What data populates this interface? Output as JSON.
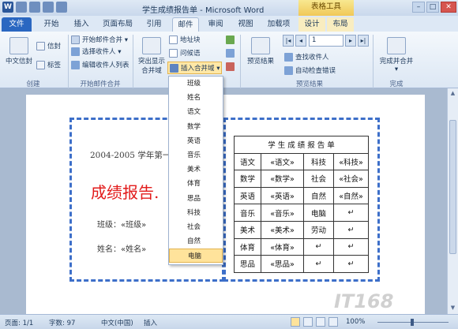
{
  "window": {
    "title": "学生成绩报告单 - Microsoft Word",
    "context_tab_group": "表格工具",
    "minimize": "–",
    "maximize": "□",
    "close": "✕"
  },
  "tabs": [
    "文件",
    "开始",
    "插入",
    "页面布局",
    "引用",
    "邮件",
    "审阅",
    "视图",
    "加载项",
    "设计",
    "布局"
  ],
  "ribbon": {
    "create_group": {
      "label": "创建",
      "envelope": "中文信封",
      "envelopes": "信封",
      "labels": "标签"
    },
    "start_group": {
      "label": "开始邮件合并",
      "start": "开始邮件合并 ▾",
      "select": "选择收件人 ▾",
      "edit": "编辑收件人列表"
    },
    "write_group": {
      "highlight": "突出显示",
      "highlight2": "合并域",
      "address": "地址块",
      "greeting": "问候语",
      "insert_field": "插入合并域 ▾"
    },
    "preview_group": {
      "label": "预览结果",
      "preview": "预览结果",
      "record": "1",
      "find": "查找收件人",
      "check": "自动检查错误"
    },
    "finish_group": {
      "label": "完成",
      "finish": "完成并合并",
      "finish2": "▾"
    }
  },
  "menu": {
    "items": [
      "班级",
      "姓名",
      "语文",
      "数学",
      "英语",
      "音乐",
      "美术",
      "体育",
      "思品",
      "科技",
      "社会",
      "自然",
      "电脑"
    ],
    "hovered": "电脑"
  },
  "document": {
    "year_line": "2004-2005 学年第一",
    "heading": "成绩报告.",
    "class_line": "班级：«班级»",
    "name_line": "姓名：«姓名»",
    "table_title": "学 生 成 绩 报 告 单",
    "table_rows": [
      [
        "语文",
        "«语文»",
        "科技",
        "«科技»"
      ],
      [
        "数学",
        "«数学»",
        "社会",
        "«社会»"
      ],
      [
        "英语",
        "«英语»",
        "自然",
        "«自然»"
      ],
      [
        "音乐",
        "«音乐»",
        "电脑",
        "↵"
      ],
      [
        "美术",
        "«美术»",
        "劳动",
        "↵"
      ],
      [
        "体育",
        "«体育»",
        "↵",
        "↵"
      ],
      [
        "思品",
        "«思品»",
        "↵",
        "↵"
      ]
    ]
  },
  "statusbar": {
    "page": "页面: 1/1",
    "words": "字数: 97",
    "language": "中文(中国)",
    "mode": "插入",
    "zoom": "100%"
  },
  "watermark": "IT168"
}
